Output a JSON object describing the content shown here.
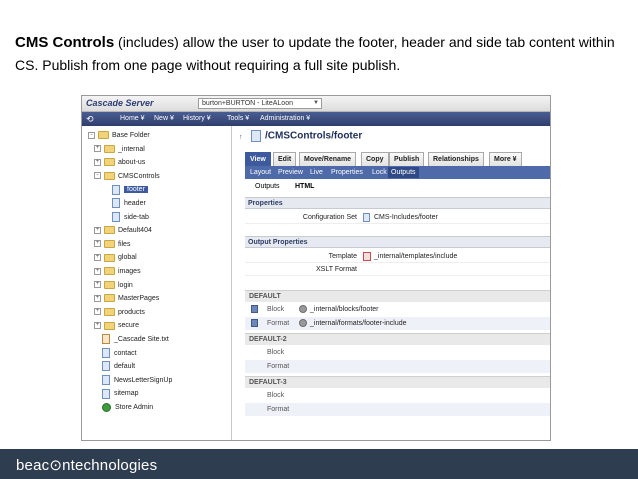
{
  "slide": {
    "heading_bold": "CMS Controls",
    "heading_rest": " (includes) allow the user to update the footer, header and side tab content within CS.  Publish from one page without requiring a full site publish."
  },
  "app": {
    "logo": "Cascade Server",
    "site_select": "burton+BURTON - LiteALoon",
    "nav": [
      "Home ¥",
      "New ¥",
      "History ¥",
      "Tools ¥",
      "Administration ¥"
    ]
  },
  "tree": {
    "items": [
      {
        "label": "Base Folder",
        "type": "folder",
        "toggle": "-"
      },
      {
        "label": "_internal",
        "type": "folder",
        "toggle": "+"
      },
      {
        "label": "about-us",
        "type": "folder",
        "toggle": "+"
      },
      {
        "label": "CMSControls",
        "type": "folder",
        "toggle": "-"
      },
      {
        "label": "footer",
        "type": "page",
        "selected": true
      },
      {
        "label": "header",
        "type": "page"
      },
      {
        "label": "side-tab",
        "type": "page"
      },
      {
        "label": "Default404",
        "type": "folder",
        "toggle": "+"
      },
      {
        "label": "files",
        "type": "folder",
        "toggle": "+"
      },
      {
        "label": "global",
        "type": "folder",
        "toggle": "+"
      },
      {
        "label": "images",
        "type": "folder",
        "toggle": "+"
      },
      {
        "label": "login",
        "type": "folder",
        "toggle": "+"
      },
      {
        "label": "MasterPages",
        "type": "folder",
        "toggle": "+"
      },
      {
        "label": "products",
        "type": "folder",
        "toggle": "+"
      },
      {
        "label": "secure",
        "type": "folder",
        "toggle": "+"
      },
      {
        "label": "_Cascade Site.txt",
        "type": "file"
      },
      {
        "label": "contact",
        "type": "page"
      },
      {
        "label": "default",
        "type": "page"
      },
      {
        "label": "NewsLetterSignUp",
        "type": "page"
      },
      {
        "label": "sitemap",
        "type": "page"
      },
      {
        "label": "Store Admin",
        "type": "globe"
      }
    ]
  },
  "content": {
    "path": "/CMSControls/footer",
    "tabs": [
      "View",
      "Edit",
      "Move/Rename",
      "Copy",
      "Publish",
      "Relationships",
      "More ¥"
    ],
    "subtabs": [
      "Layout",
      "Preview",
      "Live",
      "Properties",
      "Lock",
      "Outputs"
    ],
    "outputs_label": "Outputs",
    "outputs_value": "HTML",
    "properties_head": "Properties",
    "config_label": "Configuration Set",
    "config_value": "CMS-Includes/footer",
    "output_props_head": "Output Properties",
    "template_label": "Template",
    "template_value": "_internal/templates/include",
    "xslt_label": "XSLT Format",
    "regions": [
      {
        "name": "DEFAULT",
        "block_label": "Block",
        "block_value": "_internal/blocks/footer",
        "format_label": "Format",
        "format_value": "_internal/formats/footer-include"
      },
      {
        "name": "DEFAULT-2",
        "block_label": "Block",
        "block_value": "",
        "format_label": "Format",
        "format_value": ""
      },
      {
        "name": "DEFAULT-3",
        "block_label": "Block",
        "block_value": "",
        "format_label": "Format",
        "format_value": ""
      }
    ]
  },
  "footer": {
    "brand": "beac⊙ntechnologies"
  }
}
